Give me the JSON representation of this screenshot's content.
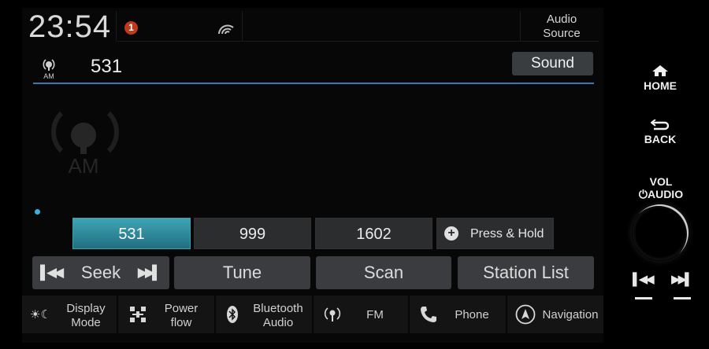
{
  "status": {
    "clock": "23:54",
    "notification_count": "1",
    "audio_source_line1": "Audio",
    "audio_source_line2": "Source"
  },
  "station": {
    "frequency": "531",
    "band_icon_label": "AM",
    "sound_label": "Sound",
    "big_band_label": "AM"
  },
  "presets": [
    "531",
    "999",
    "1602"
  ],
  "press_hold_label": "Press & Hold",
  "controls": {
    "seek": "Seek",
    "tune": "Tune",
    "scan": "Scan",
    "station_list": "Station List"
  },
  "bottom_nav": {
    "display_mode_1": "Display",
    "display_mode_2": "Mode",
    "power_flow_1": "Power",
    "power_flow_2": "flow",
    "bluetooth_1": "Bluetooth",
    "bluetooth_2": "Audio",
    "fm": "FM",
    "phone": "Phone",
    "navigation": "Navigation"
  },
  "hard_keys": {
    "home": "HOME",
    "back": "BACK",
    "vol": "VOL",
    "audio": "AUDIO"
  },
  "colors": {
    "accent": "#3fa4b5",
    "divider": "#3a76b3",
    "badge": "#c0391b"
  }
}
